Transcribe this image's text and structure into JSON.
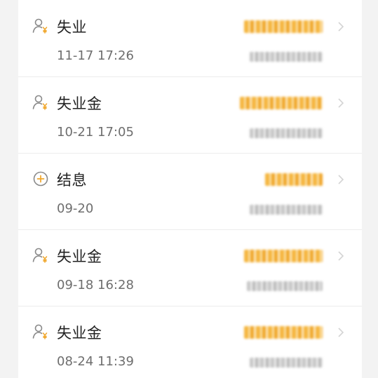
{
  "transactions": [
    {
      "title": "失业",
      "date": "11-17 17:26",
      "icon": "person-yuan-icon"
    },
    {
      "title": "失业金",
      "date": "10-21 17:05",
      "icon": "person-yuan-icon"
    },
    {
      "title": "结息",
      "date": "09-20",
      "icon": "plus-circle-icon"
    },
    {
      "title": "失业金",
      "date": "09-18 16:28",
      "icon": "person-yuan-icon"
    },
    {
      "title": "失业金",
      "date": "08-24 11:39",
      "icon": "person-yuan-icon"
    }
  ],
  "colors": {
    "icon": "#8a8a8a",
    "accent_yuan": "#f0a62a",
    "amount": "#f5b53e",
    "title": "#222222",
    "date": "#6e6e6e"
  }
}
